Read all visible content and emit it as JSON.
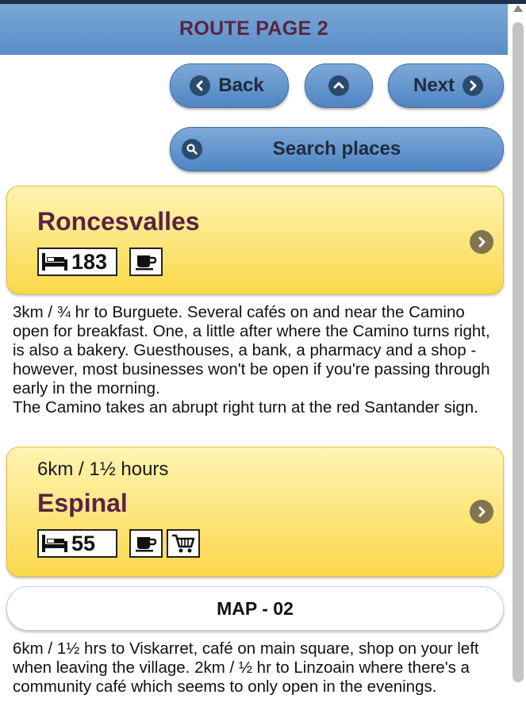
{
  "header": {
    "title": "ROUTE PAGE 2"
  },
  "nav": {
    "back_label": "Back",
    "next_label": "Next",
    "search_label": "Search places"
  },
  "places": [
    {
      "name": "Roncesvalles",
      "distance": "",
      "beds": "183",
      "amenities": [
        "cafe-icon"
      ]
    },
    {
      "name": "Espinal",
      "distance": "6km / 1½ hours",
      "beds": "55",
      "amenities": [
        "cafe-icon",
        "shop-cart-icon"
      ]
    }
  ],
  "descriptions": [
    {
      "line1": "3km / ¾ hr to Burguete. Several cafés on and near the Camino open for breakfast. One, a little after where the Camino turns right, is also a bakery. Guesthouses, a bank, a pharmacy and a shop - however, most businesses won't be open if you're passing through early in the morning.",
      "line2": "The Camino takes an abrupt right turn at the red Santander sign."
    },
    {
      "line1": "6km / 1½ hrs to Viskarret, café on main square, shop on your left when leaving the village. 2km / ½ hr to Linzoain where there's a community café which seems to only open in the evenings."
    }
  ],
  "map": {
    "label": "MAP - 02"
  },
  "colors": {
    "header_text": "#5b2340",
    "button_blue": "#5b8fc7",
    "card_yellow": "#fbd84a"
  }
}
